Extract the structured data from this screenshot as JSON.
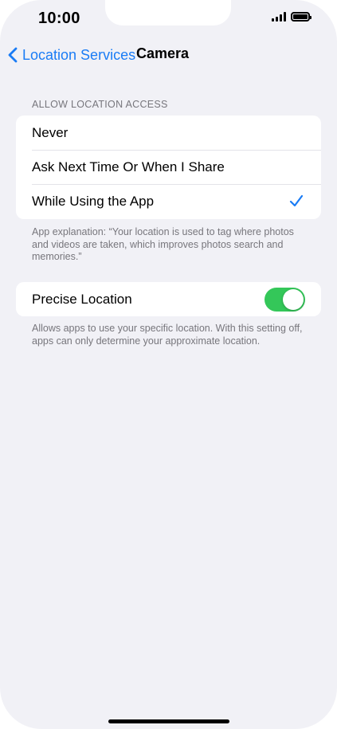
{
  "status_bar": {
    "time": "10:00"
  },
  "nav": {
    "back_label": "Location Services",
    "title": "Camera"
  },
  "allow_access": {
    "header": "ALLOW LOCATION ACCESS",
    "options": [
      {
        "label": "Never",
        "selected": false
      },
      {
        "label": "Ask Next Time Or When I Share",
        "selected": false
      },
      {
        "label": "While Using the App",
        "selected": true
      }
    ],
    "explanation": "App explanation: “Your location is used to tag where photos and videos are taken, which improves photos search and memories.”"
  },
  "precise_location": {
    "label": "Precise Location",
    "enabled": true,
    "description": "Allows apps to use your specific location. With this setting off, apps can only determine your approximate location."
  },
  "colors": {
    "accent": "#1a7cf5",
    "toggle_on": "#34c759",
    "background": "#f1f1f6"
  }
}
